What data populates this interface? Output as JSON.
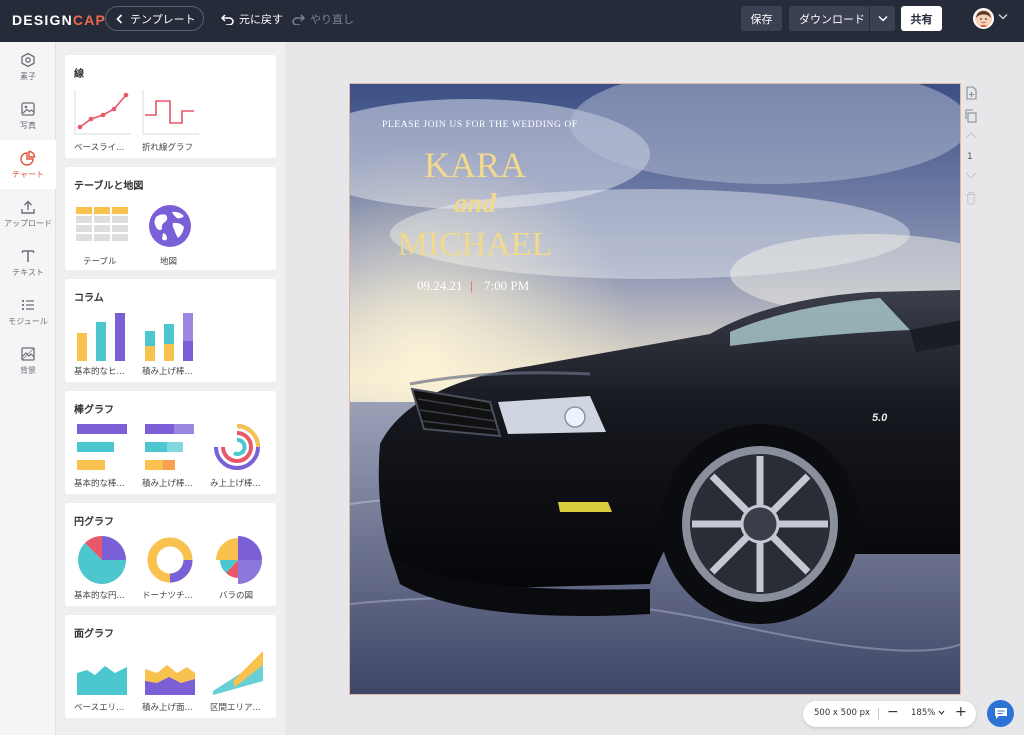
{
  "brand": {
    "part1": "DESIGN",
    "part2": "CAP"
  },
  "toolbar": {
    "templates_label": "テンプレート",
    "undo_label": "元に戻す",
    "redo_label": "やり直し",
    "save_label": "保存",
    "download_label": "ダウンロード",
    "share_label": "共有"
  },
  "rail": [
    {
      "label": "素子",
      "icon": "hexagon-icon"
    },
    {
      "label": "写真",
      "icon": "image-icon"
    },
    {
      "label": "チャート",
      "icon": "pie-chart-icon",
      "active": true
    },
    {
      "label": "アップロード",
      "icon": "upload-icon"
    },
    {
      "label": "テキスト",
      "icon": "text-icon"
    },
    {
      "label": "モジュール",
      "icon": "list-icon"
    },
    {
      "label": "背景",
      "icon": "background-icon"
    }
  ],
  "panel": {
    "sections": [
      {
        "title": "線",
        "items": [
          "ベースライ...",
          "折れ線グラフ"
        ]
      },
      {
        "title": "テーブルと地図",
        "items": [
          "テーブル",
          "地図"
        ]
      },
      {
        "title": "コラム",
        "items": [
          "基本的なヒ...",
          "積み上げ棒..."
        ]
      },
      {
        "title": "棒グラフ",
        "items": [
          "基本的な棒...",
          "積み上げ棒...",
          "み上上げ棒..."
        ]
      },
      {
        "title": "円グラフ",
        "items": [
          "基本的な円...",
          "ドーナツチ...",
          "バラの図"
        ]
      },
      {
        "title": "面グラフ",
        "items": [
          "ベースエリ...",
          "積み上げ面...",
          "区間エリア..."
        ]
      }
    ]
  },
  "design": {
    "invite_line": "PLEASE JOIN US FOR THE WEDDING OF",
    "name1": "KARA",
    "ampersand": "and",
    "name2": "MICHAEL",
    "date": "09.24.21",
    "separator": "|",
    "time": "7:00 PM",
    "badge": "5.0"
  },
  "page_tools": {
    "page_number": "1"
  },
  "zoom": {
    "size": "500 x 500 px",
    "level": "185%"
  },
  "colors": {
    "topbar": "#262b3a",
    "accent": "#e0563a",
    "title_gold": "#f2d98c",
    "chart_purple": "#7a5fd6",
    "chart_teal": "#4cc7cf",
    "chart_yellow": "#f9c24f",
    "chart_red": "#e8576a"
  }
}
